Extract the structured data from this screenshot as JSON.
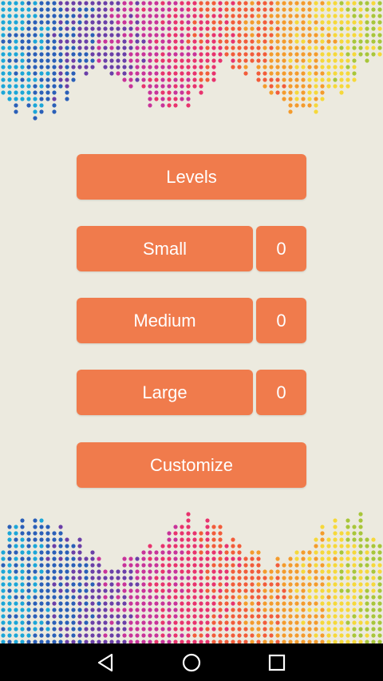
{
  "menu": {
    "levels_label": "Levels",
    "small_label": "Small",
    "small_count": "0",
    "medium_label": "Medium",
    "medium_count": "0",
    "large_label": "Large",
    "large_count": "0",
    "customize_label": "Customize"
  },
  "colors": {
    "background": "#ECEADF",
    "button": "#F07B4C",
    "button_text": "#FFFFFF",
    "navbar": "#000000",
    "spectrum": [
      "#1BA6D8",
      "#2A5FB8",
      "#6A3FA8",
      "#C8339A",
      "#E8336E",
      "#F25C3A",
      "#F49B2C",
      "#F6D83A",
      "#A8C63A"
    ]
  },
  "icons": {
    "back": "back-icon",
    "home": "home-icon",
    "recents": "recents-icon"
  }
}
